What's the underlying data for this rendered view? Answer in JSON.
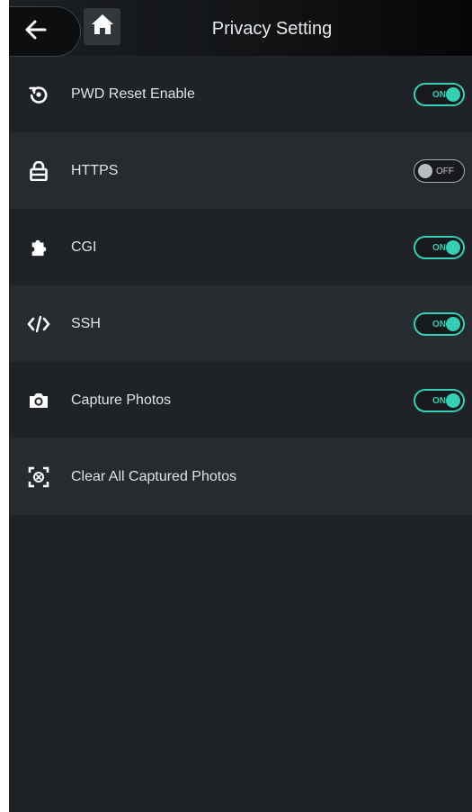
{
  "header": {
    "title": "Privacy Setting",
    "back_icon": "back-arrow-icon",
    "home_icon": "home-icon"
  },
  "settings": [
    {
      "label": "PWD Reset Enable",
      "icon": "reset-icon",
      "toggle": {
        "state": "on",
        "text": "ON"
      }
    },
    {
      "label": "HTTPS",
      "icon": "lock-icon",
      "toggle": {
        "state": "off",
        "text": "OFF"
      }
    },
    {
      "label": "CGI",
      "icon": "puzzle-icon",
      "toggle": {
        "state": "on",
        "text": "ON"
      }
    },
    {
      "label": "SSH",
      "icon": "code-icon",
      "toggle": {
        "state": "on",
        "text": "ON"
      }
    },
    {
      "label": "Capture Photos",
      "icon": "camera-icon",
      "toggle": {
        "state": "on",
        "text": "ON"
      }
    },
    {
      "label": "Clear All Captured Photos",
      "icon": "clear-photos-icon"
    }
  ],
  "colors": {
    "accent": "#35d0b4",
    "background": "#1f2328",
    "row_alt": "#262b30",
    "text": "#dfe3e6"
  }
}
